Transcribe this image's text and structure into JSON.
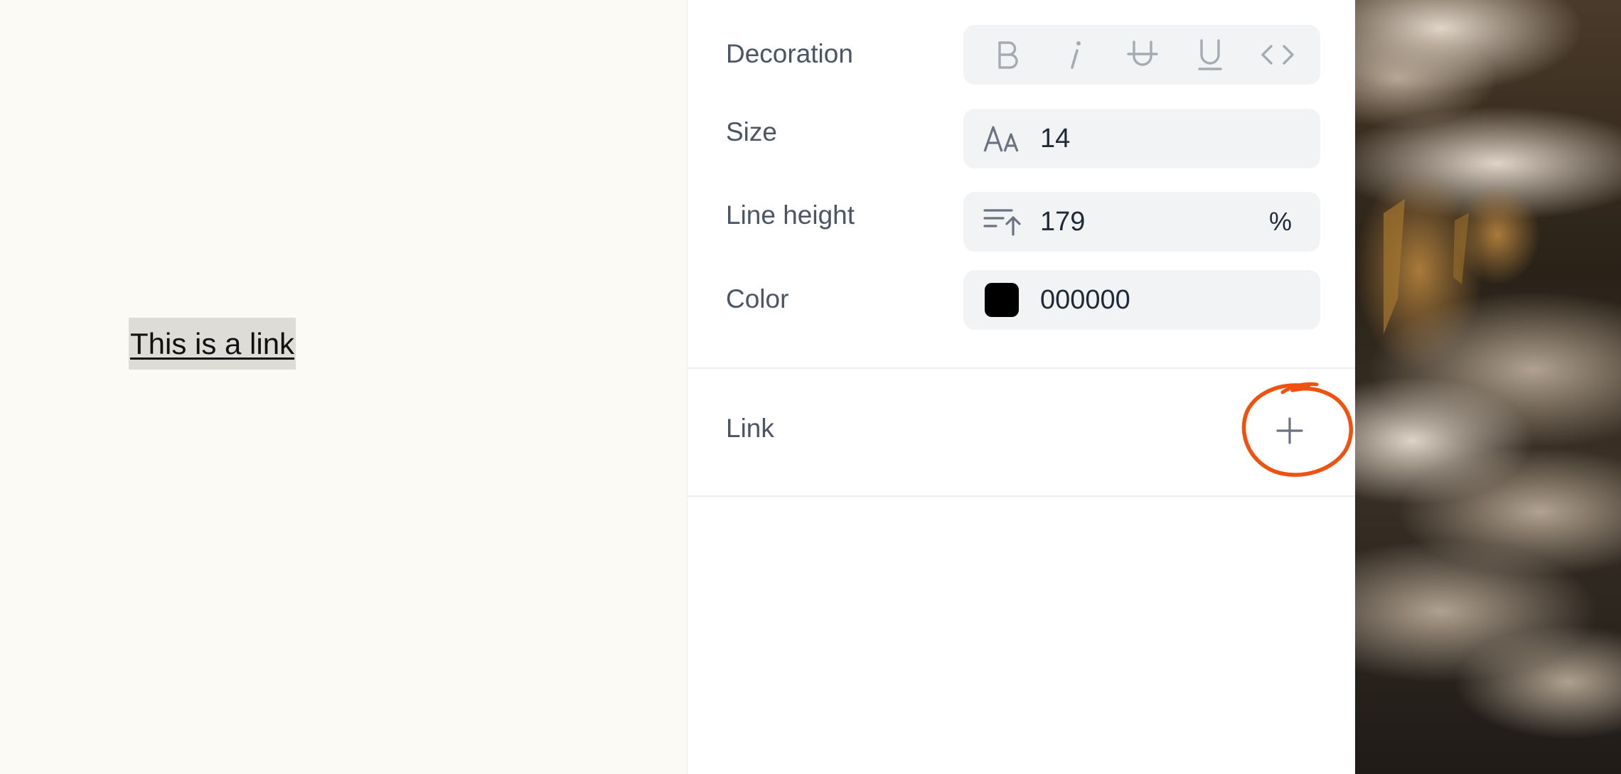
{
  "canvas": {
    "link_text": "This is a link"
  },
  "panel": {
    "decoration": {
      "label": "Decoration",
      "buttons": [
        {
          "name": "bold",
          "glyph": "B"
        },
        {
          "name": "italic",
          "glyph": "i"
        },
        {
          "name": "strikethrough",
          "glyph": "strike"
        },
        {
          "name": "underline",
          "glyph": "U"
        },
        {
          "name": "code",
          "glyph": "<>"
        }
      ]
    },
    "size": {
      "label": "Size",
      "value": "14",
      "icon": "font-size-icon"
    },
    "line_height": {
      "label": "Line height",
      "value": "179",
      "unit": "%",
      "icon": "line-height-icon"
    },
    "color": {
      "label": "Color",
      "value": "000000",
      "swatch": "#000000"
    },
    "link": {
      "label": "Link",
      "add_icon": "plus-icon"
    }
  },
  "colors": {
    "canvas_bg": "#fcfaf4",
    "highlight": "#dedcd7",
    "annotation": "#f0510f",
    "label_text": "#4b5563"
  }
}
